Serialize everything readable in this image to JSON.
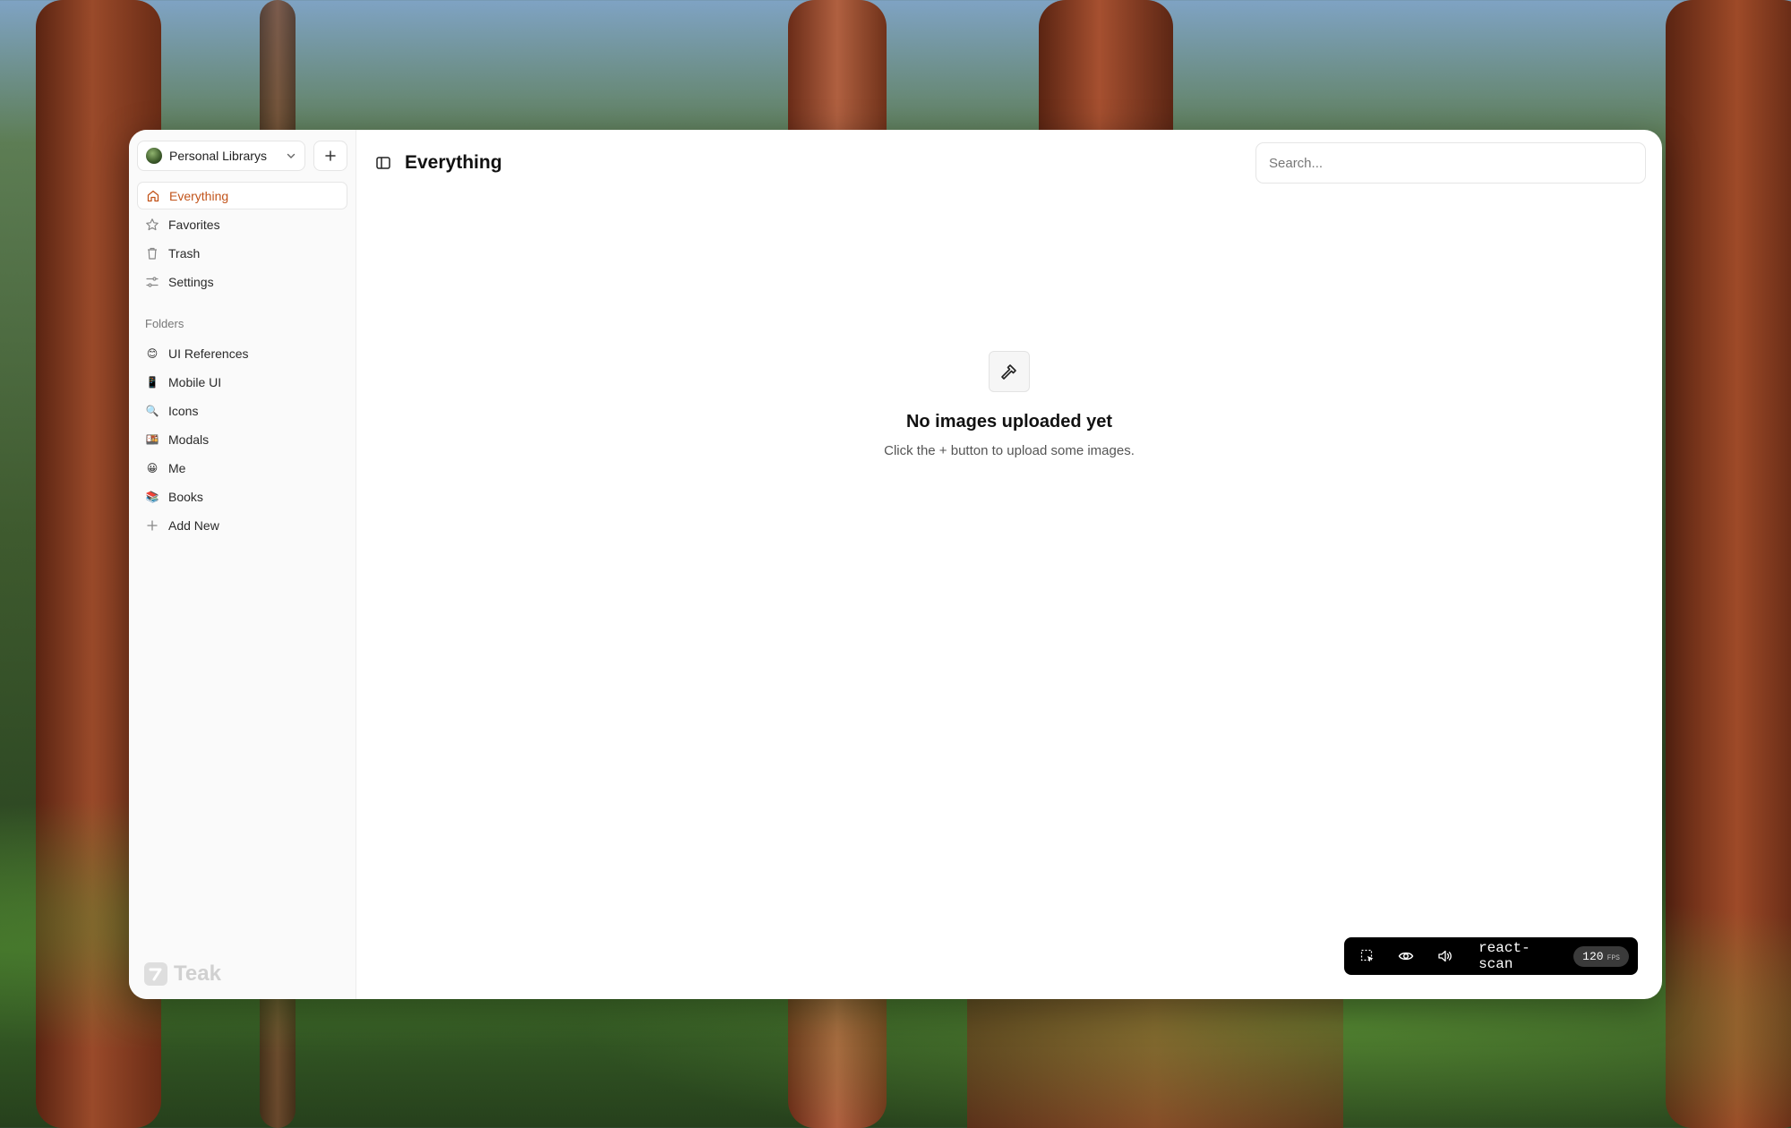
{
  "library": {
    "name": "Personal Librarys"
  },
  "nav": [
    {
      "label": "Everything",
      "icon": "home-icon",
      "active": true
    },
    {
      "label": "Favorites",
      "icon": "star-icon"
    },
    {
      "label": "Trash",
      "icon": "trash-icon"
    },
    {
      "label": "Settings",
      "icon": "settings-sliders-icon"
    }
  ],
  "folders": {
    "label": "Folders",
    "items": [
      {
        "label": "UI References",
        "emoji": "😊"
      },
      {
        "label": "Mobile UI",
        "emoji": "📱"
      },
      {
        "label": "Icons",
        "emoji": "🔍"
      },
      {
        "label": "Modals",
        "emoji": "🍱"
      },
      {
        "label": "Me",
        "emoji": "😀"
      },
      {
        "label": "Books",
        "emoji": "📚"
      }
    ],
    "add_label": "Add New"
  },
  "brand": {
    "name": "Teak"
  },
  "header": {
    "title": "Everything"
  },
  "search": {
    "placeholder": "Search..."
  },
  "empty_state": {
    "title": "No images uploaded yet",
    "subtitle": "Click the + button to upload some images."
  },
  "react_scan": {
    "name": "react-scan",
    "fps_value": "120",
    "fps_unit": "FPS"
  },
  "colors": {
    "accent": "#c2541b"
  }
}
